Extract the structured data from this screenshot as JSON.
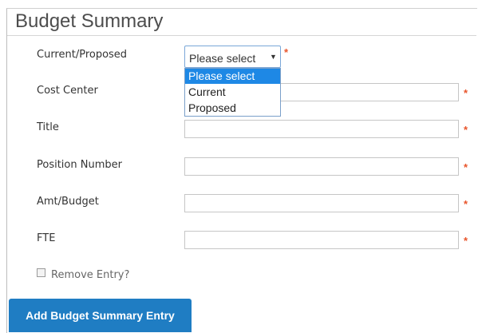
{
  "section": {
    "title": "Budget Summary"
  },
  "fields": {
    "current_proposed": {
      "label": "Current/Proposed",
      "selected": "Please select",
      "options": [
        "Please select",
        "Current",
        "Proposed"
      ],
      "required_marker": "*"
    },
    "cost_center": {
      "label": "Cost Center",
      "value": "",
      "required_marker": "*"
    },
    "title": {
      "label": "Title",
      "value": "",
      "required_marker": "*"
    },
    "position_number": {
      "label": "Position Number",
      "value": "",
      "required_marker": "*"
    },
    "amt_budget": {
      "label": "Amt/Budget",
      "value": "",
      "required_marker": "*"
    },
    "fte": {
      "label": "FTE",
      "value": "",
      "required_marker": "*"
    }
  },
  "remove_entry": {
    "label": "Remove Entry?",
    "checked": false
  },
  "actions": {
    "add_label": "Add Budget Summary Entry"
  },
  "colors": {
    "accent": "#1f7dc3",
    "selected_option": "#1e88e5",
    "required": "#e8542a"
  },
  "icons": {
    "select_arrow": "caret-down-icon"
  }
}
